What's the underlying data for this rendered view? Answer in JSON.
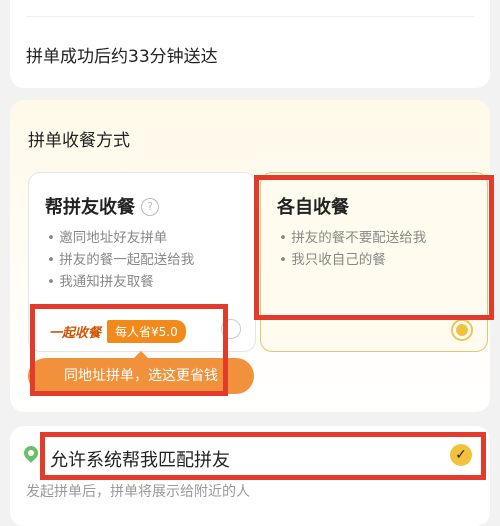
{
  "delivery": {
    "estimate_text": "拼单成功后约33分钟送达"
  },
  "method": {
    "title": "拼单收餐方式",
    "options": [
      {
        "title": "帮拼友收餐",
        "help_icon": "question-circle-icon",
        "bullets": [
          "• 邀同地址好友拼单",
          "• 拼友的餐一起配送给我",
          "• 我通知拼友取餐"
        ],
        "tag_label": "一起收餐",
        "tag_badge": "每人省¥5.0",
        "selected": false
      },
      {
        "title": "各自收餐",
        "bullets": [
          "• 拼友的餐不要配送给我",
          "• 我只收自己的餐"
        ],
        "selected": true
      }
    ],
    "promo_banner": "同地址拼单，选这更省钱"
  },
  "match": {
    "label": "允许系统帮我匹配拼友",
    "description": "发起拼单后，拼单将展示给附近的人",
    "checked": true,
    "check_icon": "check-icon",
    "location_icon": "location-pin-icon"
  },
  "colors": {
    "accent_orange": "#f18a1b",
    "accent_yellow": "#f3c23d",
    "highlight_red": "#e23a2b"
  }
}
